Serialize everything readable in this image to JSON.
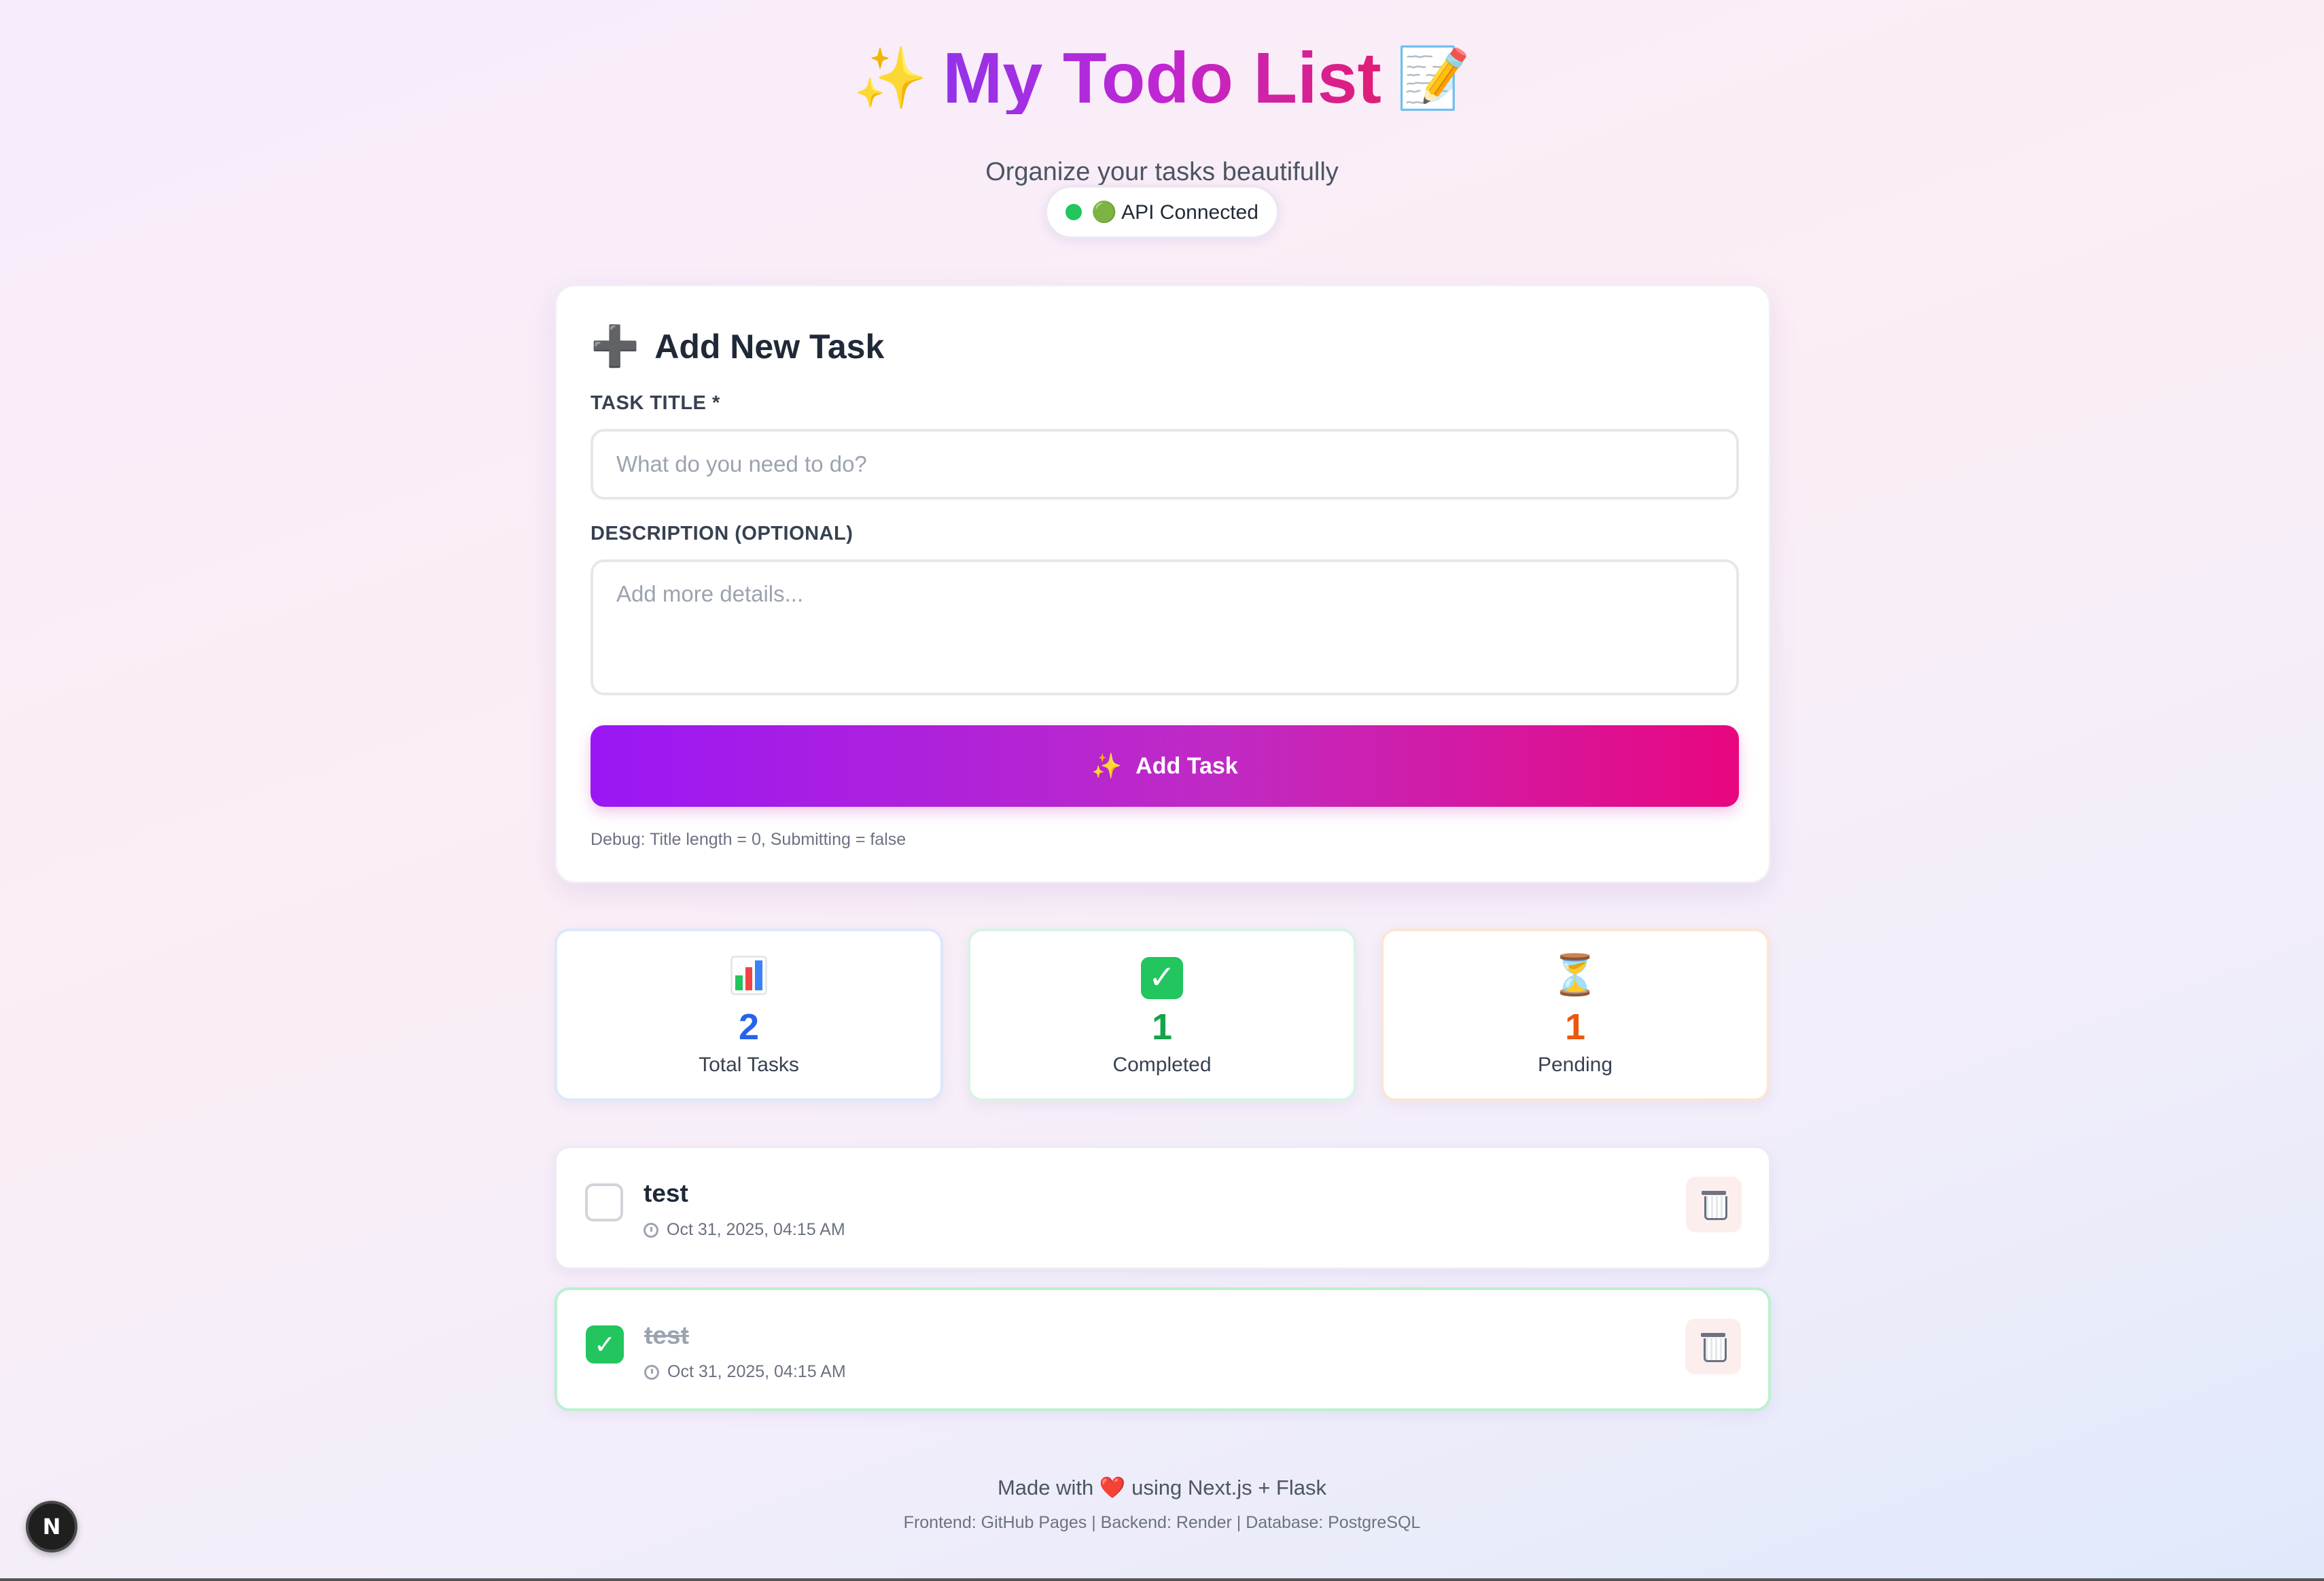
{
  "header": {
    "title_prefix_emoji": "✨",
    "title": "My Todo List",
    "title_suffix_emoji": "📝",
    "subtitle": "Organize your tasks beautifully",
    "status_text": "🟢 API Connected"
  },
  "form": {
    "heading_icon": "➕",
    "heading": "Add New Task",
    "title_label": "TASK TITLE *",
    "title_placeholder": "What do you need to do?",
    "title_value": "",
    "desc_label": "DESCRIPTION (OPTIONAL)",
    "desc_placeholder": "Add more details...",
    "desc_value": "",
    "button_icon": "✨",
    "button_label": "Add Task",
    "debug_text": "Debug: Title length = 0, Submitting = false"
  },
  "stats": [
    {
      "icon": "bar-chart-icon",
      "value": "2",
      "label": "Total Tasks",
      "color": "#2563eb"
    },
    {
      "icon": "check-mark-icon",
      "value": "1",
      "label": "Completed",
      "color": "#16a34a"
    },
    {
      "icon": "hourglass-icon",
      "value": "1",
      "label": "Pending",
      "color": "#ea580c"
    }
  ],
  "tasks": [
    {
      "title": "test",
      "time": "Oct 31, 2025, 04:15 AM",
      "completed": false
    },
    {
      "title": "test",
      "time": "Oct 31, 2025, 04:15 AM",
      "completed": true
    }
  ],
  "footer": {
    "line1_prefix": "Made with",
    "heart": "❤️",
    "line1_suffix": "using Next.js + Flask",
    "line2": "Frontend: GitHub Pages | Backend: Render | Database: PostgreSQL"
  },
  "next_badge": "N",
  "colors": {
    "accent_start": "#9a17f5",
    "accent_end": "#e8077f",
    "success": "#22c55e"
  }
}
